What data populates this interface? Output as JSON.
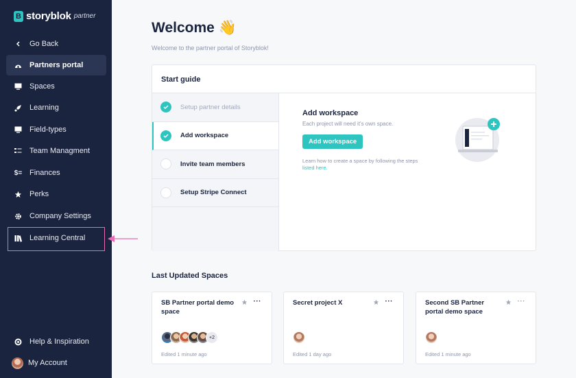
{
  "brand": {
    "logo_letter": "B",
    "name": "storyblok",
    "sub": "partner"
  },
  "sidebar": {
    "items": [
      {
        "label": "Go Back",
        "icon": "chevron-left-icon"
      },
      {
        "label": "Partners portal",
        "icon": "dashboard-icon",
        "active": true
      },
      {
        "label": "Spaces",
        "icon": "monitor-icon"
      },
      {
        "label": "Learning",
        "icon": "rocket-icon"
      },
      {
        "label": "Field-types",
        "icon": "monitor-icon"
      },
      {
        "label": "Team Managment",
        "icon": "list-icon"
      },
      {
        "label": "Finances",
        "icon": "dollar-icon"
      },
      {
        "label": "Perks",
        "icon": "star-icon"
      },
      {
        "label": "Company Settings",
        "icon": "gear-icon"
      },
      {
        "label": "Learning Central",
        "icon": "books-icon"
      }
    ],
    "bottom": [
      {
        "label": "Help & Inspiration",
        "icon": "lifebuoy-icon"
      },
      {
        "label": "My Account",
        "icon": "avatar"
      }
    ]
  },
  "main": {
    "title": "Welcome 👋",
    "subtitle": "Welcome to the partner portal of Storyblok!",
    "start_guide": {
      "heading": "Start guide",
      "steps": [
        {
          "label": "Setup partner details",
          "status": "done"
        },
        {
          "label": "Add workspace",
          "status": "done",
          "active": true
        },
        {
          "label": "Invite team members",
          "status": "todo"
        },
        {
          "label": "Setup Stripe Connect",
          "status": "todo"
        }
      ],
      "content": {
        "title": "Add workspace",
        "desc": "Each project will need it's own space.",
        "button": "Add workspace",
        "note": "Learn how to create a space by following the steps",
        "link": "listed here."
      }
    },
    "spaces_heading": "Last Updated Spaces",
    "spaces": [
      {
        "title": "SB Partner portal demo space",
        "more_count": "+2",
        "meta": "Edited 1 minute ago"
      },
      {
        "title": "Secret project X",
        "meta": "Edited 1 day ago"
      },
      {
        "title": "Second SB Partner portal demo space",
        "meta": "Edited 1 minute ago"
      }
    ]
  },
  "colors": {
    "sidebar": "#1b243f",
    "accent": "#2ec4c0",
    "highlight": "#e96ab5"
  }
}
